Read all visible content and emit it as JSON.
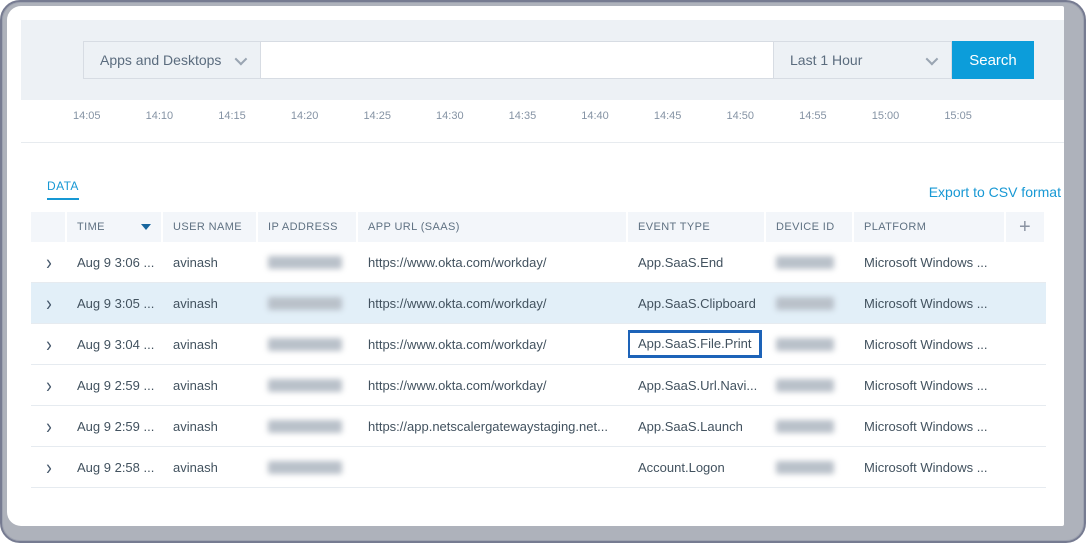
{
  "search": {
    "category_label": "Apps and Desktops",
    "query_value": "",
    "query_placeholder": "",
    "time_range_label": "Last 1 Hour",
    "button_label": "Search"
  },
  "timeline": {
    "ticks": [
      "14:05",
      "14:10",
      "14:15",
      "14:20",
      "14:25",
      "14:30",
      "14:35",
      "14:40",
      "14:45",
      "14:50",
      "14:55",
      "15:00",
      "15:05"
    ]
  },
  "data_section": {
    "tab_label": "DATA",
    "export_label": "Export to CSV format"
  },
  "table": {
    "columns": {
      "time": "TIME",
      "user": "USER NAME",
      "ip": "IP ADDRESS",
      "url": "APP URL (SAAS)",
      "event": "EVENT TYPE",
      "device": "DEVICE ID",
      "platform": "PLATFORM"
    },
    "add_column_glyph": "+",
    "expand_glyph": "›",
    "rows": [
      {
        "time": "Aug 9 3:06 ...",
        "user": "avinash",
        "url": "https://www.okta.com/workday/",
        "event": "App.SaaS.End",
        "platform": "Microsoft Windows ..."
      },
      {
        "time": "Aug 9 3:05 ...",
        "user": "avinash",
        "url": "https://www.okta.com/workday/",
        "event": "App.SaaS.Clipboard",
        "platform": "Microsoft Windows ..."
      },
      {
        "time": "Aug 9 3:04 ...",
        "user": "avinash",
        "url": "https://www.okta.com/workday/",
        "event": "App.SaaS.File.Print",
        "platform": "Microsoft Windows ..."
      },
      {
        "time": "Aug 9 2:59 ...",
        "user": "avinash",
        "url": "https://www.okta.com/workday/",
        "event": "App.SaaS.Url.Navi...",
        "platform": "Microsoft Windows ..."
      },
      {
        "time": "Aug 9 2:59 ...",
        "user": "avinash",
        "url": "https://app.netscalergatewaystaging.net...",
        "event": "App.SaaS.Launch",
        "platform": "Microsoft Windows ..."
      },
      {
        "time": "Aug 9 2:58 ...",
        "user": "avinash",
        "url": "",
        "event": "Account.Logon",
        "platform": "Microsoft Windows ..."
      }
    ]
  },
  "colors": {
    "accent_blue": "#0c9dda",
    "link_blue": "#1798d4",
    "event_box_border": "#1d63b8",
    "row_highlight": "#e2eff8",
    "header_cell_bg": "#f3f6fa",
    "section_bg": "#edf1f5"
  }
}
